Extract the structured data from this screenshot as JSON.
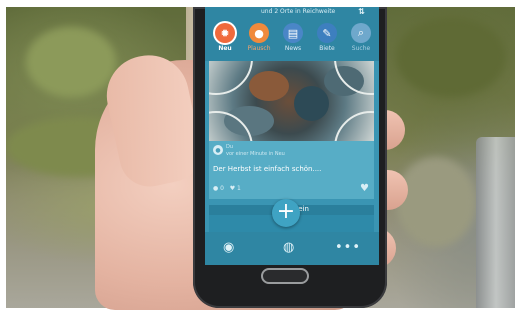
{
  "app": {
    "header_subtitle": "und 2 Orte in Reichweite",
    "sort_icon": "sort-icon",
    "tabs": [
      {
        "label": "Neu",
        "icon": "flame-icon",
        "color": "#f06a3c",
        "active": true
      },
      {
        "label": "Plausch",
        "icon": "chat-bubble-icon",
        "color": "#f08a3c",
        "active": false
      },
      {
        "label": "News",
        "icon": "newspaper-icon",
        "color": "#4a86c7",
        "active": false
      },
      {
        "label": "Biete",
        "icon": "pencil-icon",
        "color": "#3d7fbf",
        "active": false
      },
      {
        "label": "Suche",
        "icon": "search-icon",
        "color": "#6fa8cc",
        "active": false
      }
    ]
  },
  "post": {
    "author": "Du",
    "meta": "vor einer Minute in Neu",
    "text": "Der Herbst ist einfach schön....",
    "comments": "0",
    "likes": "1",
    "like_icon": "heart-icon"
  },
  "next_section": {
    "title": "Allgemein"
  },
  "fab": {
    "label": "+"
  },
  "bottom_nav": [
    {
      "icon": "broadcast-icon"
    },
    {
      "icon": "profile-icon"
    },
    {
      "icon": "more-icon"
    }
  ],
  "colors": {
    "header": "#2f86a3",
    "card": "#57adc6",
    "accent": "#3fa3c3"
  }
}
